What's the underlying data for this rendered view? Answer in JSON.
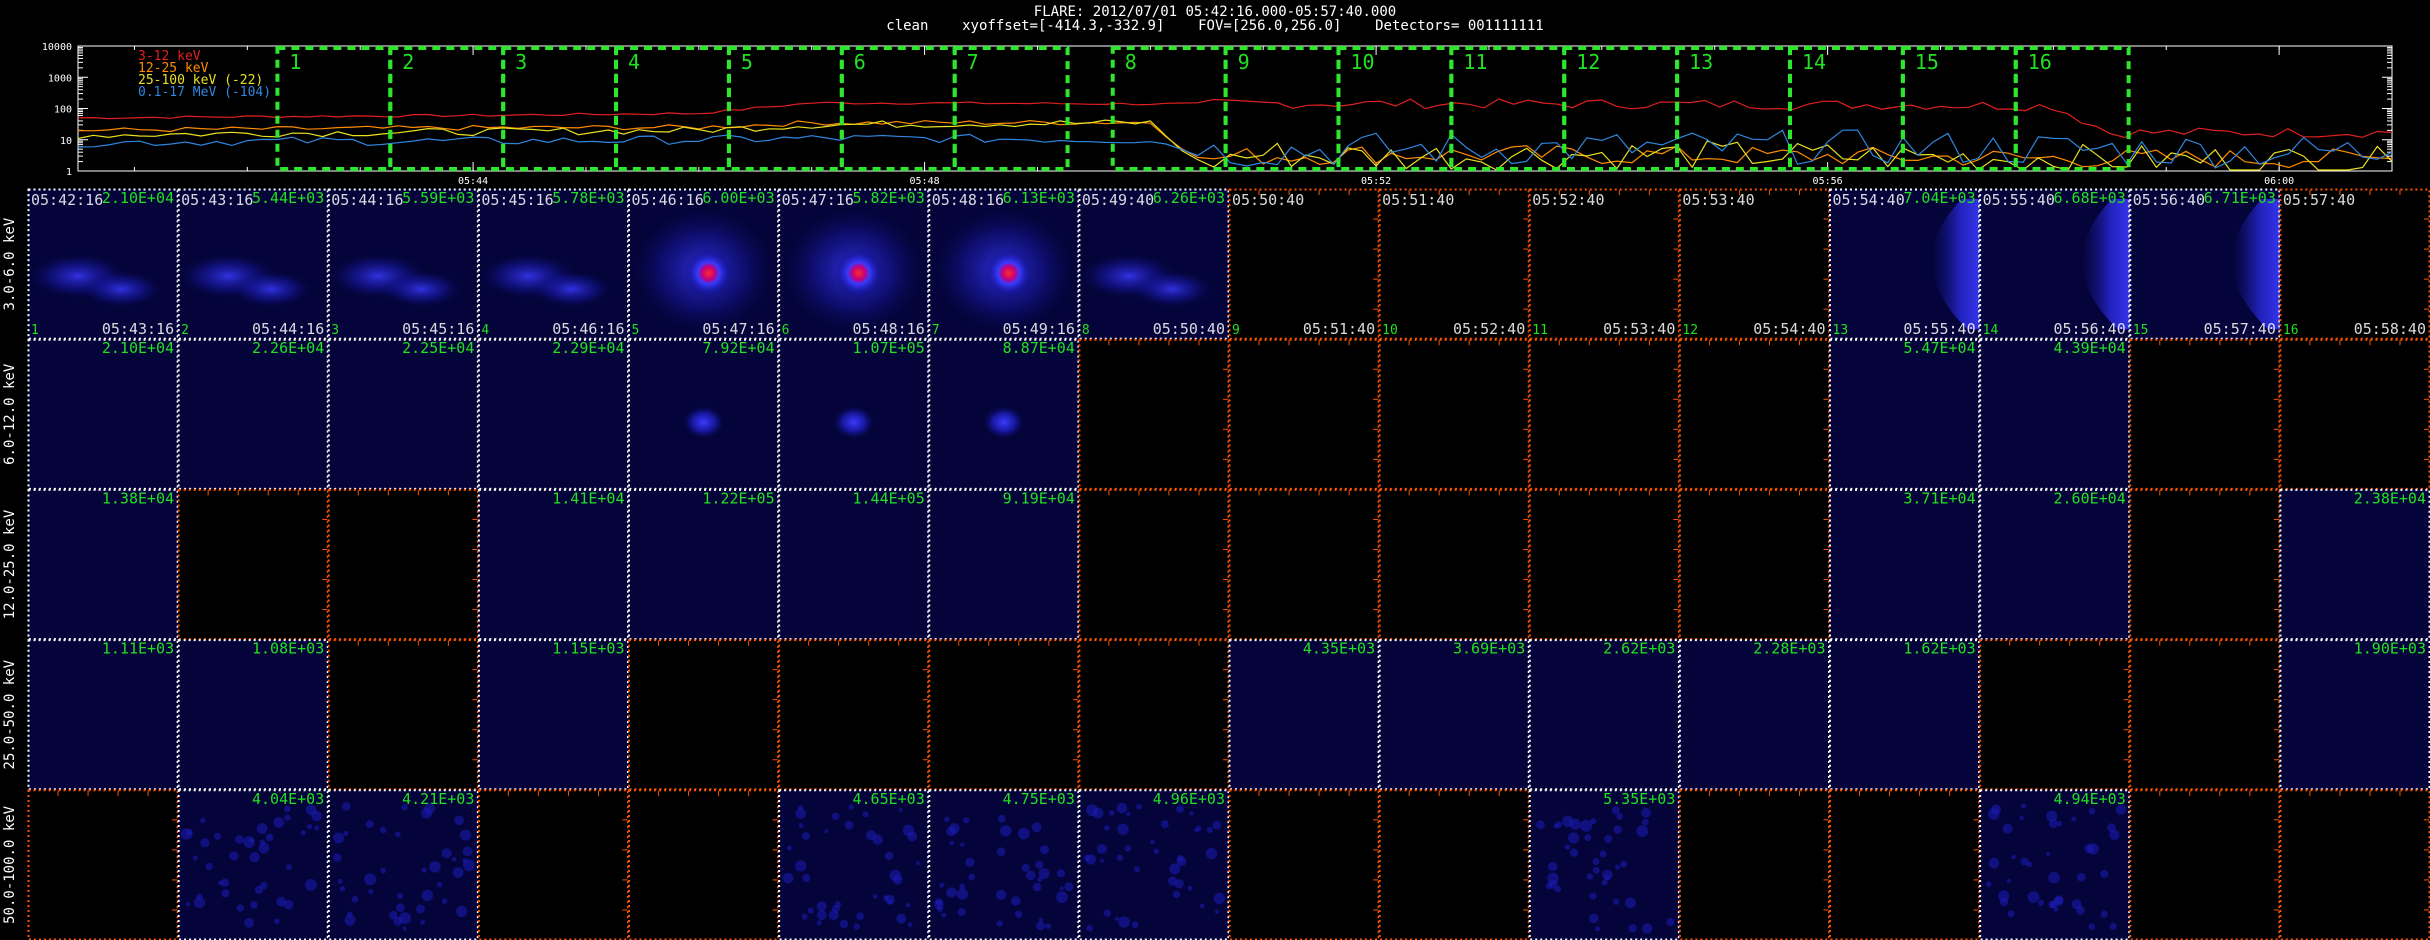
{
  "header": {
    "title": "FLARE: 2012/07/01 05:42:16.000-05:57:40.000",
    "subtitle": "clean    xyoffset=[-414.3,-332.9]    FOV=[256.0,256.0]    Detectors= 001111111"
  },
  "colors": {
    "red": "#e02020",
    "orange": "#ff8c00",
    "yellow": "#e8e020",
    "blue": "#2f86e0",
    "green_box": "#2ee62e",
    "grid_orange": "#ff5500",
    "frame_white": "#ffffff",
    "bg": "#000000"
  },
  "chart_data": {
    "type": "line",
    "y_scale": "log",
    "ylim": [
      1,
      10000
    ],
    "y_ticks": [
      "10000",
      "1000",
      "100",
      "10",
      "1"
    ],
    "x_ticks": [
      "05:44",
      "05:48",
      "05:52",
      "05:56",
      "06:00"
    ],
    "xlim": [
      "05:40:30",
      "06:01:00"
    ],
    "x_tick_values": [
      "05:44:00",
      "05:48:00",
      "05:52:00",
      "05:56:00",
      "06:00:00"
    ],
    "legend": [
      "3-12 keV",
      "12-25 keV",
      "25-100 keV (-22)",
      "0.1-17 MeV (-104)"
    ],
    "series": [
      {
        "name": "3-12 keV",
        "color": "#e02020",
        "x": [
          "05:40:30",
          "05:42:00",
          "05:44:00",
          "05:46:00",
          "05:47:00",
          "05:48:00",
          "05:50:00",
          "05:50:25",
          "05:51:00",
          "05:54:00",
          "05:57:00",
          "05:58:00",
          "05:58:30",
          "06:01:00"
        ],
        "y": [
          50,
          55,
          60,
          70,
          150,
          150,
          140,
          140,
          145,
          140,
          130,
          120,
          17,
          17
        ]
      },
      {
        "name": "12-25 keV",
        "color": "#ff8c00",
        "x": [
          "05:40:30",
          "05:42:00",
          "05:44:00",
          "05:46:00",
          "05:47:00",
          "05:48:00",
          "05:50:00",
          "05:50:25",
          "05:51:00",
          "05:52:00",
          "05:54:00",
          "05:56:00",
          "05:58:00",
          "06:01:00"
        ],
        "y": [
          20,
          22,
          24,
          25,
          35,
          35,
          36,
          2.5,
          3,
          3.5,
          3.2,
          3,
          2.5,
          2.5
        ]
      },
      {
        "name": "25-100 keV (-22)",
        "color": "#e8e020",
        "x": [
          "05:40:30",
          "05:42:00",
          "05:44:00",
          "05:46:00",
          "05:47:00",
          "05:48:00",
          "05:50:00",
          "05:50:25",
          "05:51:00",
          "05:52:00",
          "05:54:00",
          "05:56:00",
          "05:58:00",
          "06:01:00"
        ],
        "y": [
          14,
          16,
          18,
          20,
          30,
          32,
          35,
          2,
          3.5,
          2.8,
          3.5,
          3,
          2.5,
          2
        ]
      },
      {
        "name": "0.1-17 MeV (-104)",
        "color": "#2f86e0",
        "x": [
          "05:40:30",
          "05:42:00",
          "05:44:00",
          "05:46:00",
          "05:47:00",
          "05:48:00",
          "05:50:00",
          "05:50:25",
          "05:51:00",
          "05:52:00",
          "05:54:00",
          "05:56:00",
          "05:58:00",
          "06:01:00"
        ],
        "y": [
          8,
          9,
          9,
          10,
          11,
          11,
          10,
          4,
          4.5,
          5,
          5.5,
          6,
          5,
          4
        ]
      }
    ],
    "intervals": [
      {
        "label": "1",
        "start": "05:42:16",
        "end": "05:43:16"
      },
      {
        "label": "2",
        "start": "05:43:16",
        "end": "05:44:16"
      },
      {
        "label": "3",
        "start": "05:44:16",
        "end": "05:45:16"
      },
      {
        "label": "4",
        "start": "05:45:16",
        "end": "05:46:16"
      },
      {
        "label": "5",
        "start": "05:46:16",
        "end": "05:47:16"
      },
      {
        "label": "6",
        "start": "05:47:16",
        "end": "05:48:16"
      },
      {
        "label": "7",
        "start": "05:48:16",
        "end": "05:49:16"
      },
      {
        "label": "8",
        "start": "05:49:40",
        "end": "05:50:40"
      },
      {
        "label": "9",
        "start": "05:50:40",
        "end": "05:51:40"
      },
      {
        "label": "10",
        "start": "05:51:40",
        "end": "05:52:40"
      },
      {
        "label": "11",
        "start": "05:52:40",
        "end": "05:53:40"
      },
      {
        "label": "12",
        "start": "05:53:40",
        "end": "05:54:40"
      },
      {
        "label": "13",
        "start": "05:54:40",
        "end": "05:55:40"
      },
      {
        "label": "14",
        "start": "05:55:40",
        "end": "05:56:40"
      },
      {
        "label": "15",
        "start": "05:56:40",
        "end": "05:57:40"
      },
      {
        "label": "16",
        "start": "05:57:40",
        "end": "05:58:40"
      }
    ]
  },
  "image_grid": {
    "start_times": [
      "05:42:16",
      "05:43:16",
      "05:44:16",
      "05:45:16",
      "05:46:16",
      "05:47:16",
      "05:48:16",
      "05:49:40",
      "05:50:40",
      "05:51:40",
      "05:52:40",
      "05:53:40",
      "05:54:40",
      "05:55:40",
      "05:56:40",
      "05:57:40"
    ],
    "end_times": [
      "05:43:16",
      "05:44:16",
      "05:45:16",
      "05:46:16",
      "05:47:16",
      "05:48:16",
      "05:49:16",
      "05:50:40",
      "05:51:40",
      "05:52:40",
      "05:53:40",
      "05:54:40",
      "05:55:40",
      "05:56:40",
      "05:57:40",
      "05:58:40"
    ],
    "rows": [
      {
        "label": "3.0-6.0 keV",
        "cells": [
          {
            "type": "image",
            "max": "2.10E+04",
            "blob": "diffuse"
          },
          {
            "type": "image",
            "max": "5.44E+03",
            "blob": "diffuse"
          },
          {
            "type": "image",
            "max": "5.59E+03",
            "blob": "diffuse"
          },
          {
            "type": "image",
            "max": "5.78E+03",
            "blob": "diffuse"
          },
          {
            "type": "image",
            "max": "6.00E+03",
            "blob": "core"
          },
          {
            "type": "image",
            "max": "5.82E+03",
            "blob": "core"
          },
          {
            "type": "image",
            "max": "6.13E+03",
            "blob": "core"
          },
          {
            "type": "image",
            "max": "6.26E+03",
            "blob": "diffuse"
          },
          {
            "type": "empty",
            "max": ""
          },
          {
            "type": "empty",
            "max": ""
          },
          {
            "type": "empty",
            "max": ""
          },
          {
            "type": "empty",
            "max": ""
          },
          {
            "type": "image",
            "max": "7.04E+03",
            "blob": "arc"
          },
          {
            "type": "image",
            "max": "6.68E+03",
            "blob": "arc"
          },
          {
            "type": "image",
            "max": "6.71E+03",
            "blob": "arc"
          },
          {
            "type": "empty",
            "max": ""
          }
        ]
      },
      {
        "label": "6.0-12.0 keV",
        "cells": [
          {
            "type": "image",
            "max": "2.10E+04",
            "blob": "none"
          },
          {
            "type": "image",
            "max": "2.26E+04",
            "blob": "none"
          },
          {
            "type": "image",
            "max": "2.25E+04",
            "blob": "none"
          },
          {
            "type": "image",
            "max": "2.29E+04",
            "blob": "none"
          },
          {
            "type": "image",
            "max": "7.92E+04",
            "blob": "dot"
          },
          {
            "type": "image",
            "max": "1.07E+05",
            "blob": "dot"
          },
          {
            "type": "image",
            "max": "8.87E+04",
            "blob": "dot"
          },
          {
            "type": "empty",
            "max": ""
          },
          {
            "type": "empty",
            "max": ""
          },
          {
            "type": "empty",
            "max": ""
          },
          {
            "type": "empty",
            "max": ""
          },
          {
            "type": "empty",
            "max": ""
          },
          {
            "type": "image",
            "max": "5.47E+04",
            "blob": "none"
          },
          {
            "type": "image",
            "max": "4.39E+04",
            "blob": "none"
          },
          {
            "type": "empty",
            "max": ""
          },
          {
            "type": "empty",
            "max": ""
          }
        ]
      },
      {
        "label": "12.0-25.0 keV",
        "cells": [
          {
            "type": "image",
            "max": "1.38E+04",
            "blob": "none"
          },
          {
            "type": "empty",
            "max": ""
          },
          {
            "type": "empty",
            "max": ""
          },
          {
            "type": "image",
            "max": "1.41E+04",
            "blob": "none"
          },
          {
            "type": "image",
            "max": "1.22E+05",
            "blob": "none"
          },
          {
            "type": "image",
            "max": "1.44E+05",
            "blob": "none"
          },
          {
            "type": "image",
            "max": "9.19E+04",
            "blob": "none"
          },
          {
            "type": "empty",
            "max": ""
          },
          {
            "type": "empty",
            "max": ""
          },
          {
            "type": "empty",
            "max": ""
          },
          {
            "type": "empty",
            "max": ""
          },
          {
            "type": "empty",
            "max": ""
          },
          {
            "type": "image",
            "max": "3.71E+04",
            "blob": "none"
          },
          {
            "type": "image",
            "max": "2.60E+04",
            "blob": "none"
          },
          {
            "type": "empty",
            "max": ""
          },
          {
            "type": "image",
            "max": "2.38E+04",
            "blob": "none"
          }
        ]
      },
      {
        "label": "25.0-50.0 keV",
        "cells": [
          {
            "type": "image",
            "max": "1.11E+03",
            "blob": "none"
          },
          {
            "type": "image",
            "max": "1.08E+03",
            "blob": "none"
          },
          {
            "type": "empty",
            "max": ""
          },
          {
            "type": "image",
            "max": "1.15E+03",
            "blob": "none"
          },
          {
            "type": "empty",
            "max": ""
          },
          {
            "type": "empty",
            "max": ""
          },
          {
            "type": "empty",
            "max": ""
          },
          {
            "type": "empty",
            "max": ""
          },
          {
            "type": "image",
            "max": "4.35E+03",
            "blob": "none"
          },
          {
            "type": "image",
            "max": "3.69E+03",
            "blob": "none"
          },
          {
            "type": "image",
            "max": "2.62E+03",
            "blob": "none"
          },
          {
            "type": "image",
            "max": "2.28E+03",
            "blob": "none"
          },
          {
            "type": "image",
            "max": "1.62E+03",
            "blob": "none"
          },
          {
            "type": "empty",
            "max": ""
          },
          {
            "type": "empty",
            "max": ""
          },
          {
            "type": "image",
            "max": "1.90E+03",
            "blob": "none"
          }
        ]
      },
      {
        "label": "50.0-100.0 keV",
        "cells": [
          {
            "type": "empty",
            "max": ""
          },
          {
            "type": "image",
            "max": "4.04E+03",
            "blob": "noise"
          },
          {
            "type": "image",
            "max": "4.21E+03",
            "blob": "noise"
          },
          {
            "type": "empty",
            "max": ""
          },
          {
            "type": "empty",
            "max": ""
          },
          {
            "type": "image",
            "max": "4.65E+03",
            "blob": "noise"
          },
          {
            "type": "image",
            "max": "4.75E+03",
            "blob": "noise"
          },
          {
            "type": "image",
            "max": "4.96E+03",
            "blob": "noise"
          },
          {
            "type": "empty",
            "max": ""
          },
          {
            "type": "empty",
            "max": ""
          },
          {
            "type": "image",
            "max": "5.35E+03",
            "blob": "noise"
          },
          {
            "type": "empty",
            "max": ""
          },
          {
            "type": "empty",
            "max": ""
          },
          {
            "type": "image",
            "max": "4.94E+03",
            "blob": "noise"
          },
          {
            "type": "empty",
            "max": ""
          },
          {
            "type": "empty",
            "max": ""
          }
        ]
      }
    ]
  }
}
